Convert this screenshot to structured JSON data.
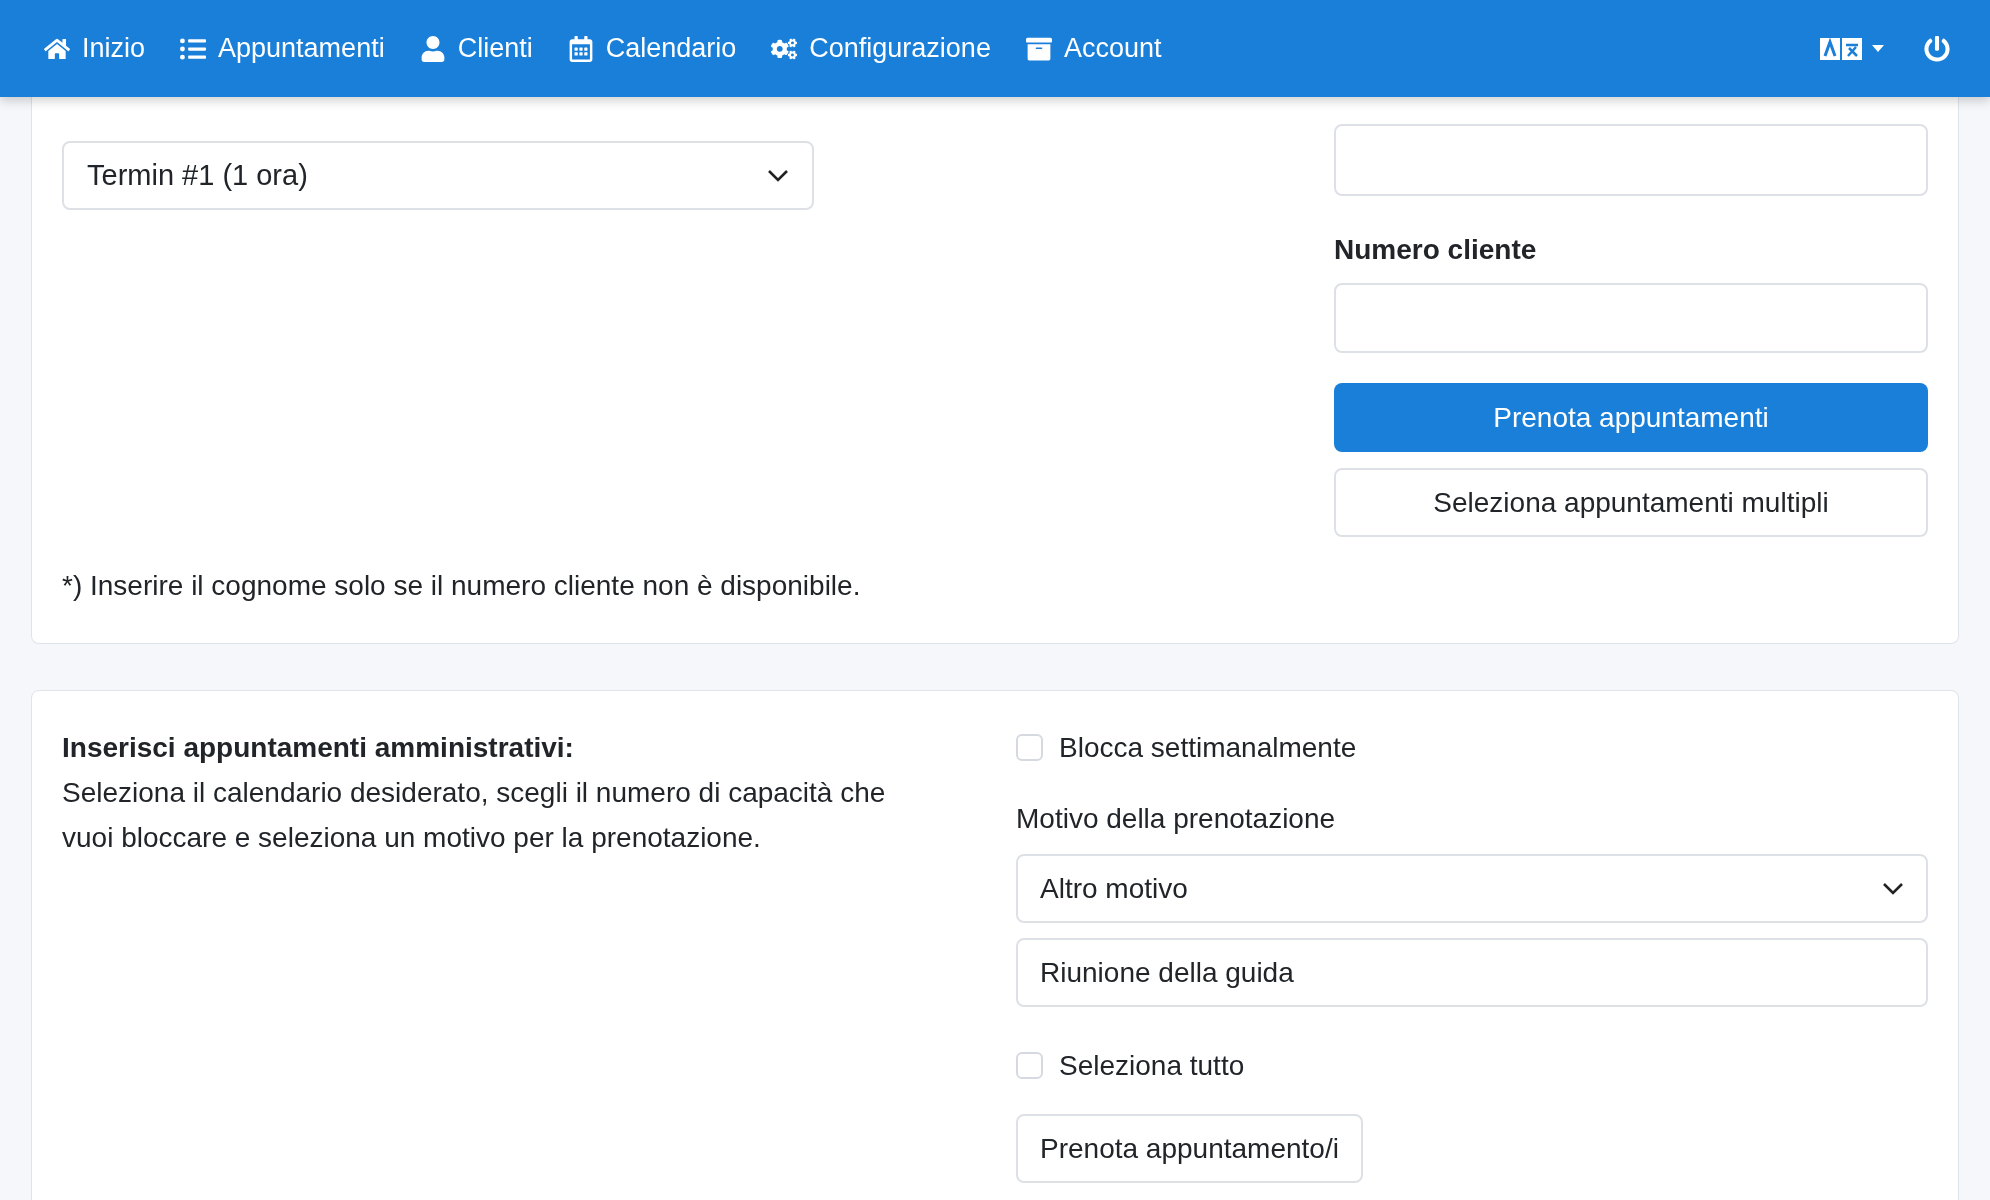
{
  "navbar": {
    "items": [
      {
        "label": "Inizio"
      },
      {
        "label": "Appuntamenti"
      },
      {
        "label": "Clienti"
      },
      {
        "label": "Calendario"
      },
      {
        "label": "Configurazione"
      },
      {
        "label": "Account"
      }
    ]
  },
  "booking_card": {
    "appointment_select": {
      "value": "Termin #1 (1 ora)"
    },
    "customer_number": {
      "label": "Numero cliente"
    },
    "buttons": [
      {
        "label": "Prenota appuntamenti",
        "kind": "primary"
      },
      {
        "label": "Seleziona appuntamenti multipli",
        "kind": "outline"
      }
    ],
    "footnote": "*) Inserire il cognome solo se il numero cliente non è disponibile."
  },
  "admin_card": {
    "title": "Inserisci appuntamenti amministrativi:",
    "description": "Seleziona il calendario desiderato, scegli il numero di capacità che vuoi bloccare e seleziona un motivo per la prenotazione.",
    "weekly_block": {
      "label": "Blocca settimanalmente",
      "checked": false
    },
    "reason_label": "Motivo della prenotazione",
    "reason_select": {
      "value": "Altro motivo"
    },
    "reason_text": {
      "value": "Riunione della guida"
    },
    "select_all": {
      "label": "Seleziona tutto",
      "checked": false
    },
    "submit": {
      "label": "Prenota appuntamento/i"
    }
  }
}
